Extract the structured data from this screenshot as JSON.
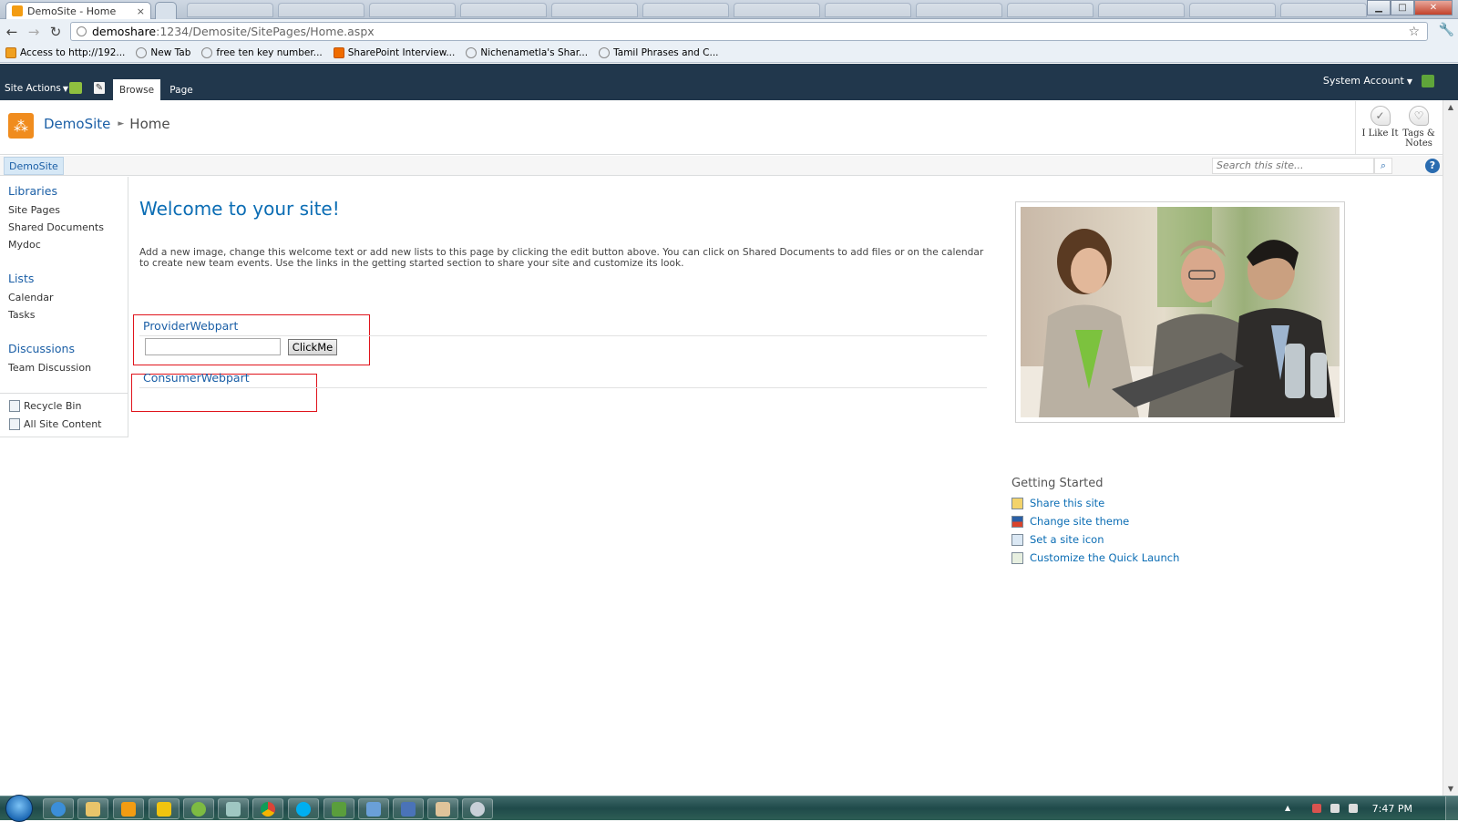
{
  "browser": {
    "tab_title": "DemoSite - Home",
    "tab_close": "×",
    "url_host": "demoshare",
    "url_path": ":1234/Demosite/SitePages/Home.aspx",
    "bookmarks": [
      "Access to http://192...",
      "New Tab",
      "free ten key number...",
      "SharePoint Interview...",
      "Nichenametla's Shar...",
      "Tamil Phrases and C..."
    ]
  },
  "ribbon": {
    "site_actions": "Site Actions",
    "tab_browse": "Browse",
    "tab_page": "Page",
    "account": "System Account"
  },
  "title_area": {
    "site": "DemoSite",
    "page": "Home",
    "like_label": "I Like It",
    "tags_label_1": "Tags &",
    "tags_label_2": "Notes"
  },
  "topnav": {
    "site_tab": "DemoSite",
    "search_placeholder": "Search this site...",
    "help": "?"
  },
  "quicklaunch": {
    "libraries": "Libraries",
    "library_items": [
      "Site Pages",
      "Shared Documents",
      "Mydoc"
    ],
    "lists": "Lists",
    "list_items": [
      "Calendar",
      "Tasks"
    ],
    "discussions": "Discussions",
    "discussion_items": [
      "Team Discussion"
    ],
    "recycle_bin": "Recycle Bin",
    "all_content": "All Site Content"
  },
  "main": {
    "welcome": "Welcome to your site!",
    "intro": "Add a new image, change this welcome text or add new lists to this page by clicking the edit button above. You can click on Shared Documents to add files or on the calendar to create new team events. Use the links in the getting started section to share your site and customize its look.",
    "provider_title": "ProviderWebpart",
    "provider_input_value": "",
    "clickme": "ClickMe",
    "consumer_title": "ConsumerWebpart"
  },
  "getting_started": {
    "title": "Getting Started",
    "items": [
      "Share this site",
      "Change site theme",
      "Set a site icon",
      "Customize the Quick Launch"
    ]
  },
  "taskbar": {
    "clock": "7:47 PM"
  },
  "colors": {
    "ribbon_bg": "#21374c",
    "link": "#0b6db4",
    "webpart_outline": "#e0141c"
  }
}
